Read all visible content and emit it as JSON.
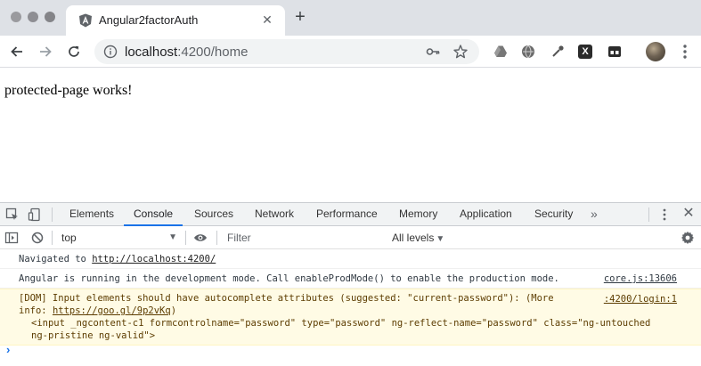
{
  "tab": {
    "title": "Angular2factorAuth",
    "close": "✕",
    "new_tab": "+"
  },
  "toolbar": {
    "url_host": "localhost",
    "url_rest": ":4200/home"
  },
  "page": {
    "text": "protected-page works!"
  },
  "devtools": {
    "tabs": [
      "Elements",
      "Console",
      "Sources",
      "Network",
      "Performance",
      "Memory",
      "Application",
      "Security"
    ],
    "active_tab": "Console",
    "more": "»",
    "close": "✕",
    "context": "top",
    "filter_placeholder": "Filter",
    "levels": "All levels",
    "prompt": "›"
  },
  "console": {
    "nav_prefix": "Navigated to ",
    "nav_url": "http://localhost:4200/",
    "dev_mode": "Angular is running in the development mode. Call enableProdMode() to enable the production mode.",
    "dev_mode_src": "core.js:13606",
    "warn_text": "[DOM] Input elements should have autocomplete attributes (suggested: \"current-password\"): (More",
    "warn_src": ":4200/login:1",
    "warn_info_prefix": "info: ",
    "warn_info_url": "https://goo.gl/9p2vKq",
    "warn_info_suffix": ")",
    "warn_el_1": "<input _ngcontent-c1 formcontrolname=\"password\" type=\"password\" ng-reflect-name=\"password\" class=\"ng-untouched",
    "warn_el_2": "ng-pristine ng-valid\">"
  }
}
